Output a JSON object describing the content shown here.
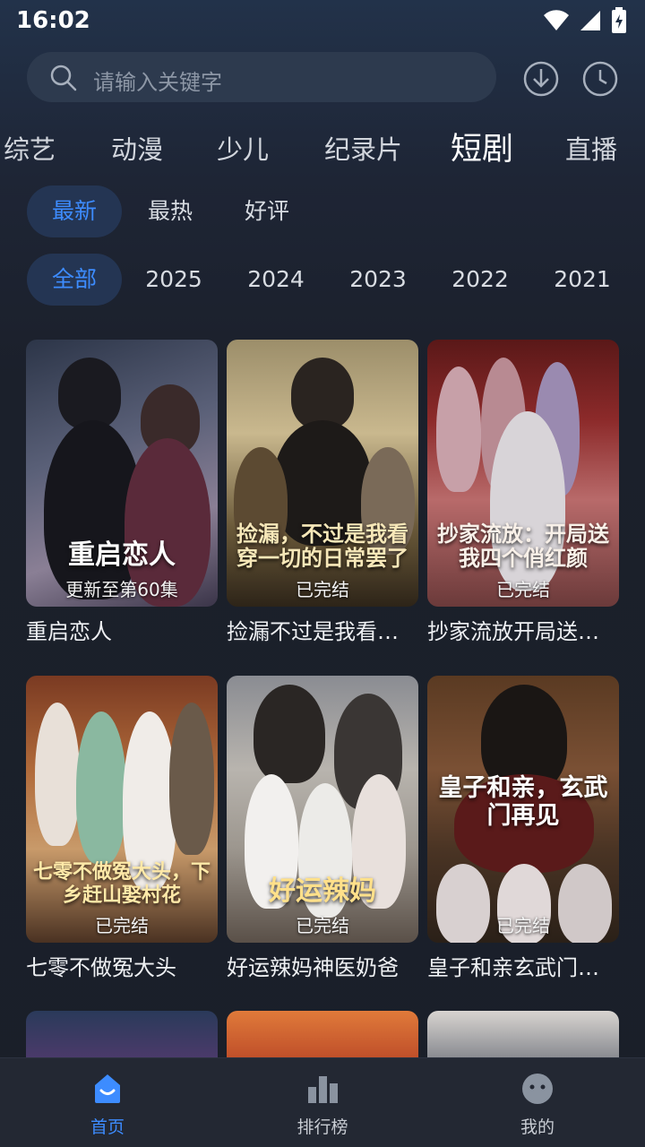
{
  "status_bar": {
    "time": "16:02"
  },
  "search": {
    "placeholder": "请输入关键字"
  },
  "category_tabs": [
    "综艺",
    "动漫",
    "少儿",
    "纪录片",
    "短剧",
    "直播"
  ],
  "active_category": "短剧",
  "sort_options": [
    "最新",
    "最热",
    "好评"
  ],
  "active_sort": "最新",
  "year_options": [
    "全部",
    "2025",
    "2024",
    "2023",
    "2022",
    "2021"
  ],
  "active_year": "全部",
  "cards": [
    {
      "title": "重启恋人",
      "poster_text": "重启恋人",
      "badge": "更新至第60集"
    },
    {
      "title": "捡漏不过是我看穿一切的日常罢了",
      "poster_text": "捡漏，不过是我看穿一切的日常罢了",
      "badge": "已完结"
    },
    {
      "title": "抄家流放开局送我四个俏红颜",
      "poster_text": "抄家流放：开局送我四个俏红颜",
      "badge": "已完结"
    },
    {
      "title": "七零不做冤大头",
      "poster_text": "七零不做冤大头，下乡赶山娶村花",
      "badge": "已完结"
    },
    {
      "title": "好运辣妈神医奶爸",
      "poster_text": "好运辣妈",
      "badge": "已完结"
    },
    {
      "title": "皇子和亲玄武门再见",
      "poster_text": "皇子和亲，玄武门再见",
      "badge": "已完结"
    }
  ],
  "bottom_nav": [
    {
      "label": "首页",
      "icon": "home-icon"
    },
    {
      "label": "排行榜",
      "icon": "chart-icon"
    },
    {
      "label": "我的",
      "icon": "profile-icon"
    }
  ],
  "active_nav": "首页",
  "colors": {
    "accent": "#3d8cff",
    "background": "#1a1f2a",
    "chip_active_bg": "#243553"
  }
}
